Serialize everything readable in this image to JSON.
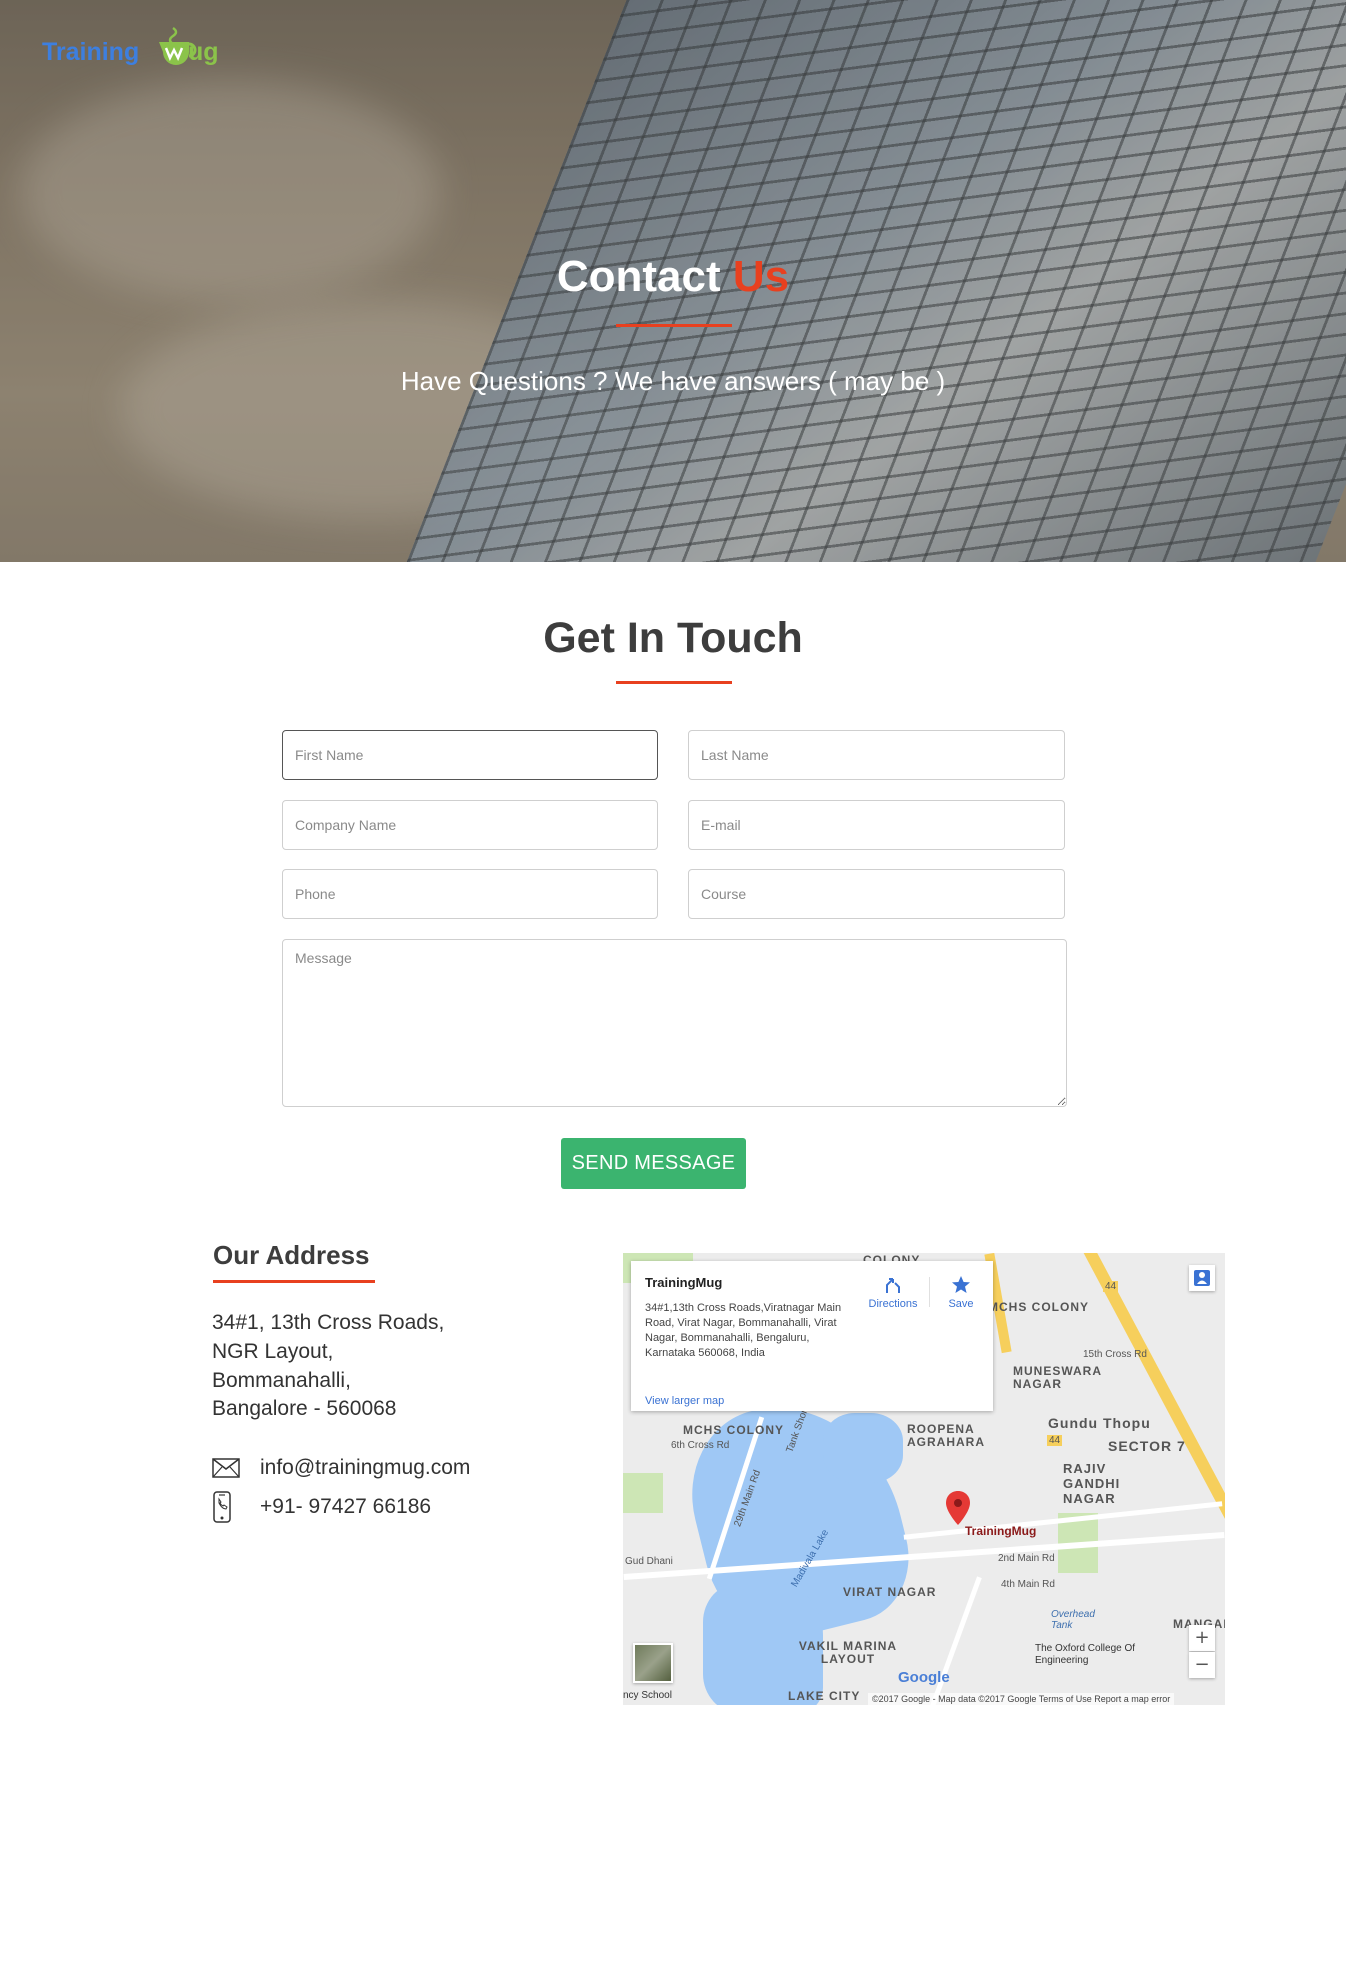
{
  "brand": {
    "logo_part1": "Training",
    "logo_part2": "ug"
  },
  "hero": {
    "title_main": "Contact",
    "title_accent": "Us",
    "subtitle": "Have Questions ?  We have answers ( may be )"
  },
  "form": {
    "title": "Get In Touch",
    "first_name_placeholder": "First Name",
    "last_name_placeholder": "Last Name",
    "company_placeholder": "Company Name",
    "email_placeholder": "E-mail",
    "phone_placeholder": "Phone",
    "course_placeholder": "Course",
    "message_placeholder": "Message",
    "send_label": "SEND MESSAGE"
  },
  "address": {
    "title": "Our Address",
    "lines": [
      "34#1, 13th Cross Roads,",
      "NGR Layout,",
      "Bommanahalli,",
      "Bangalore - 560068"
    ],
    "email": "info@trainingmug.com",
    "phone": "+91- 97427 66186"
  },
  "map": {
    "card_title": "TrainingMug",
    "card_address": "34#1,13th Cross Roads,Viratnagar Main Road, Virat Nagar, Bommanahalli, Virat Nagar, Bommanahalli, Bengaluru, Karnataka 560068, India",
    "view_larger": "View larger map",
    "directions": "Directions",
    "save": "Save",
    "pin_label": "TrainingMug",
    "google": "Google",
    "footer": "©2017 Google - Map data ©2017 Google     Terms of Use     Report a map error",
    "labels": {
      "colony_top": "COLONY",
      "mchs_right": "MCHS COLONY",
      "cross15": "15th Cross Rd",
      "muneswara": "MUNESWARA NAGAR",
      "gundu": "Gundu Thopu",
      "sector7": "SECTOR 7",
      "rajiv": "RAJIV GANDHI NAGAR",
      "roopena": "ROOPENA AGRAHARA",
      "mchs_left": "MCHS COLONY",
      "cross6": "6th Cross Rd",
      "main29": "29th Main Rd",
      "tank": "Tank Shore",
      "madivala": "Madivala Lake",
      "gud_dhani": "Gud Dhani",
      "virat": "VIRAT NAGAR",
      "main2": "2nd Main Rd",
      "main4": "4th Main Rd",
      "vakil": "VAKIL MARINA LAYOUT",
      "oxford": "The Oxford College Of Engineering",
      "lakecity": "LAKE CITY",
      "school": "ncy School",
      "overhead": "Overhead Tank",
      "mangan": "MANGAN",
      "road44": "44"
    }
  },
  "colors": {
    "accent": "#e8401f",
    "button": "#3bb46f",
    "logo_blue": "#3d7fe0",
    "logo_green": "#8bc34a"
  }
}
